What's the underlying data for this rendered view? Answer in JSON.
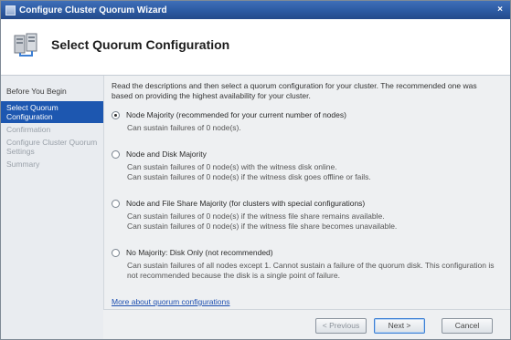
{
  "window": {
    "title": "Configure Cluster Quorum Wizard",
    "close_glyph": "×"
  },
  "header": {
    "heading": "Select Quorum Configuration",
    "icon": "cluster-wizard-icon"
  },
  "sidebar": {
    "items": [
      {
        "label": "Before You Begin",
        "state": "normal"
      },
      {
        "label": "Select Quorum Configuration",
        "state": "active"
      },
      {
        "label": "Confirmation",
        "state": "dim"
      },
      {
        "label": "Configure Cluster Quorum Settings",
        "state": "dim"
      },
      {
        "label": "Summary",
        "state": "dim"
      }
    ]
  },
  "main": {
    "intro": "Read the descriptions and then select a quorum configuration for your cluster. The recommended one was based on providing the highest availability for your cluster.",
    "options": [
      {
        "label": "Node Majority (recommended for your current number of nodes)",
        "desc": "Can sustain failures of 0 node(s).",
        "checked": true
      },
      {
        "label": "Node and Disk Majority",
        "desc": "Can sustain failures of 0 node(s) with the witness disk online.\nCan sustain failures of 0 node(s) if the witness disk goes offline or fails.",
        "checked": false
      },
      {
        "label": "Node and File Share Majority (for clusters with special configurations)",
        "desc": "Can sustain failures of 0 node(s) if the witness file share remains available.\nCan sustain failures of 0 node(s) if the witness file share becomes unavailable.",
        "checked": false
      },
      {
        "label": "No Majority: Disk Only (not recommended)",
        "desc": "Can sustain failures of all nodes except 1. Cannot sustain a failure of the quorum disk. This configuration is not recommended because the disk is a single point of failure.",
        "checked": false
      }
    ],
    "more_link": "More about quorum configurations"
  },
  "footer": {
    "previous_label": "< Previous",
    "next_label": "Next >",
    "cancel_label": "Cancel"
  },
  "colors": {
    "titlebar": "#2c5aa2",
    "active_nav": "#1d57b0",
    "link": "#1d4fb0"
  }
}
